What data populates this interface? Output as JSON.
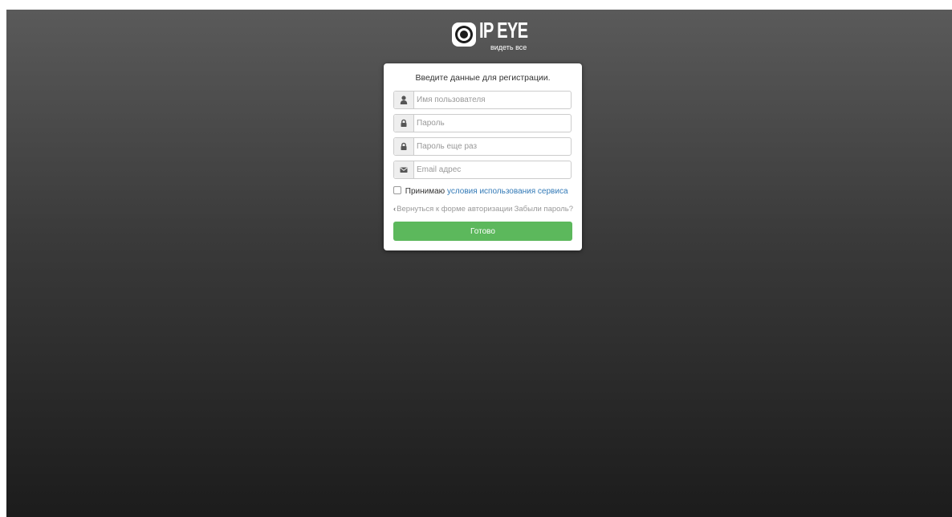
{
  "logo": {
    "brand": "IP EYE",
    "slogan": "видеть все"
  },
  "form": {
    "title": "Введите данные для регистрации.",
    "username_placeholder": "Имя пользователя",
    "password_placeholder": "Пароль",
    "password_repeat_placeholder": "Пароль еще раз",
    "email_placeholder": "Email адрес",
    "accept_label": "Принимаю",
    "terms_link": "условия использования сервиса",
    "back_link": "Вернуться к форме авторизации",
    "forgot_link": "Забыли пароль?",
    "submit_label": "Готово"
  },
  "icons": {
    "username": "user-icon",
    "password": "lock-icon",
    "password_repeat": "lock-icon",
    "email": "envelope-icon",
    "back": "chevron-left-icon"
  },
  "colors": {
    "submit": "#5cb85c",
    "link": "#337ab7",
    "muted_link": "#999999"
  }
}
